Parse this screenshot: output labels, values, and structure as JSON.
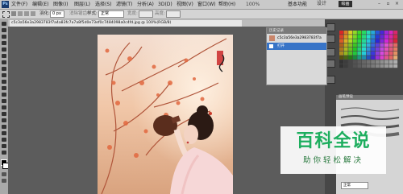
{
  "app": {
    "logo_text": "Ps",
    "menu": [
      "文件(F)",
      "编辑(E)",
      "图像(I)",
      "图层(L)",
      "选择(S)",
      "滤镜(T)",
      "分析(A)",
      "3D(D)",
      "视图(V)",
      "窗口(W)",
      "帮助(H)"
    ],
    "zoom_level": "100%",
    "workspace_label": "基本功能",
    "workspace_design": "设计",
    "workspace_active": "绘画"
  },
  "options": {
    "feather_label": "羽化:",
    "feather_value": "0 px",
    "antialias_label": "消除锯齿",
    "style_label": "样式:",
    "style_value": "正常",
    "width_label": "宽度:",
    "height_label": "高度:"
  },
  "document": {
    "tab_title": "c5c3a56e3a2983783f7a4a83fc7a7a8f5d0e73ef0c7484098a0c4fd.jpg @ 100%(RGB/8)"
  },
  "history": {
    "header": "历史记录",
    "snapshot_name": "c5c3a56e3a2983783f7a",
    "open_label": "打开"
  },
  "brushes": {
    "header": "画笔预设",
    "mode_value": "正常"
  },
  "watermark": {
    "title": "百科全说",
    "subtitle": "助你轻松解决"
  },
  "photo": {
    "seal_text": "凉州词",
    "seal_small": "詩林"
  },
  "colors": {
    "accent": "#1dae5e",
    "history_highlight": "#3874c7"
  }
}
